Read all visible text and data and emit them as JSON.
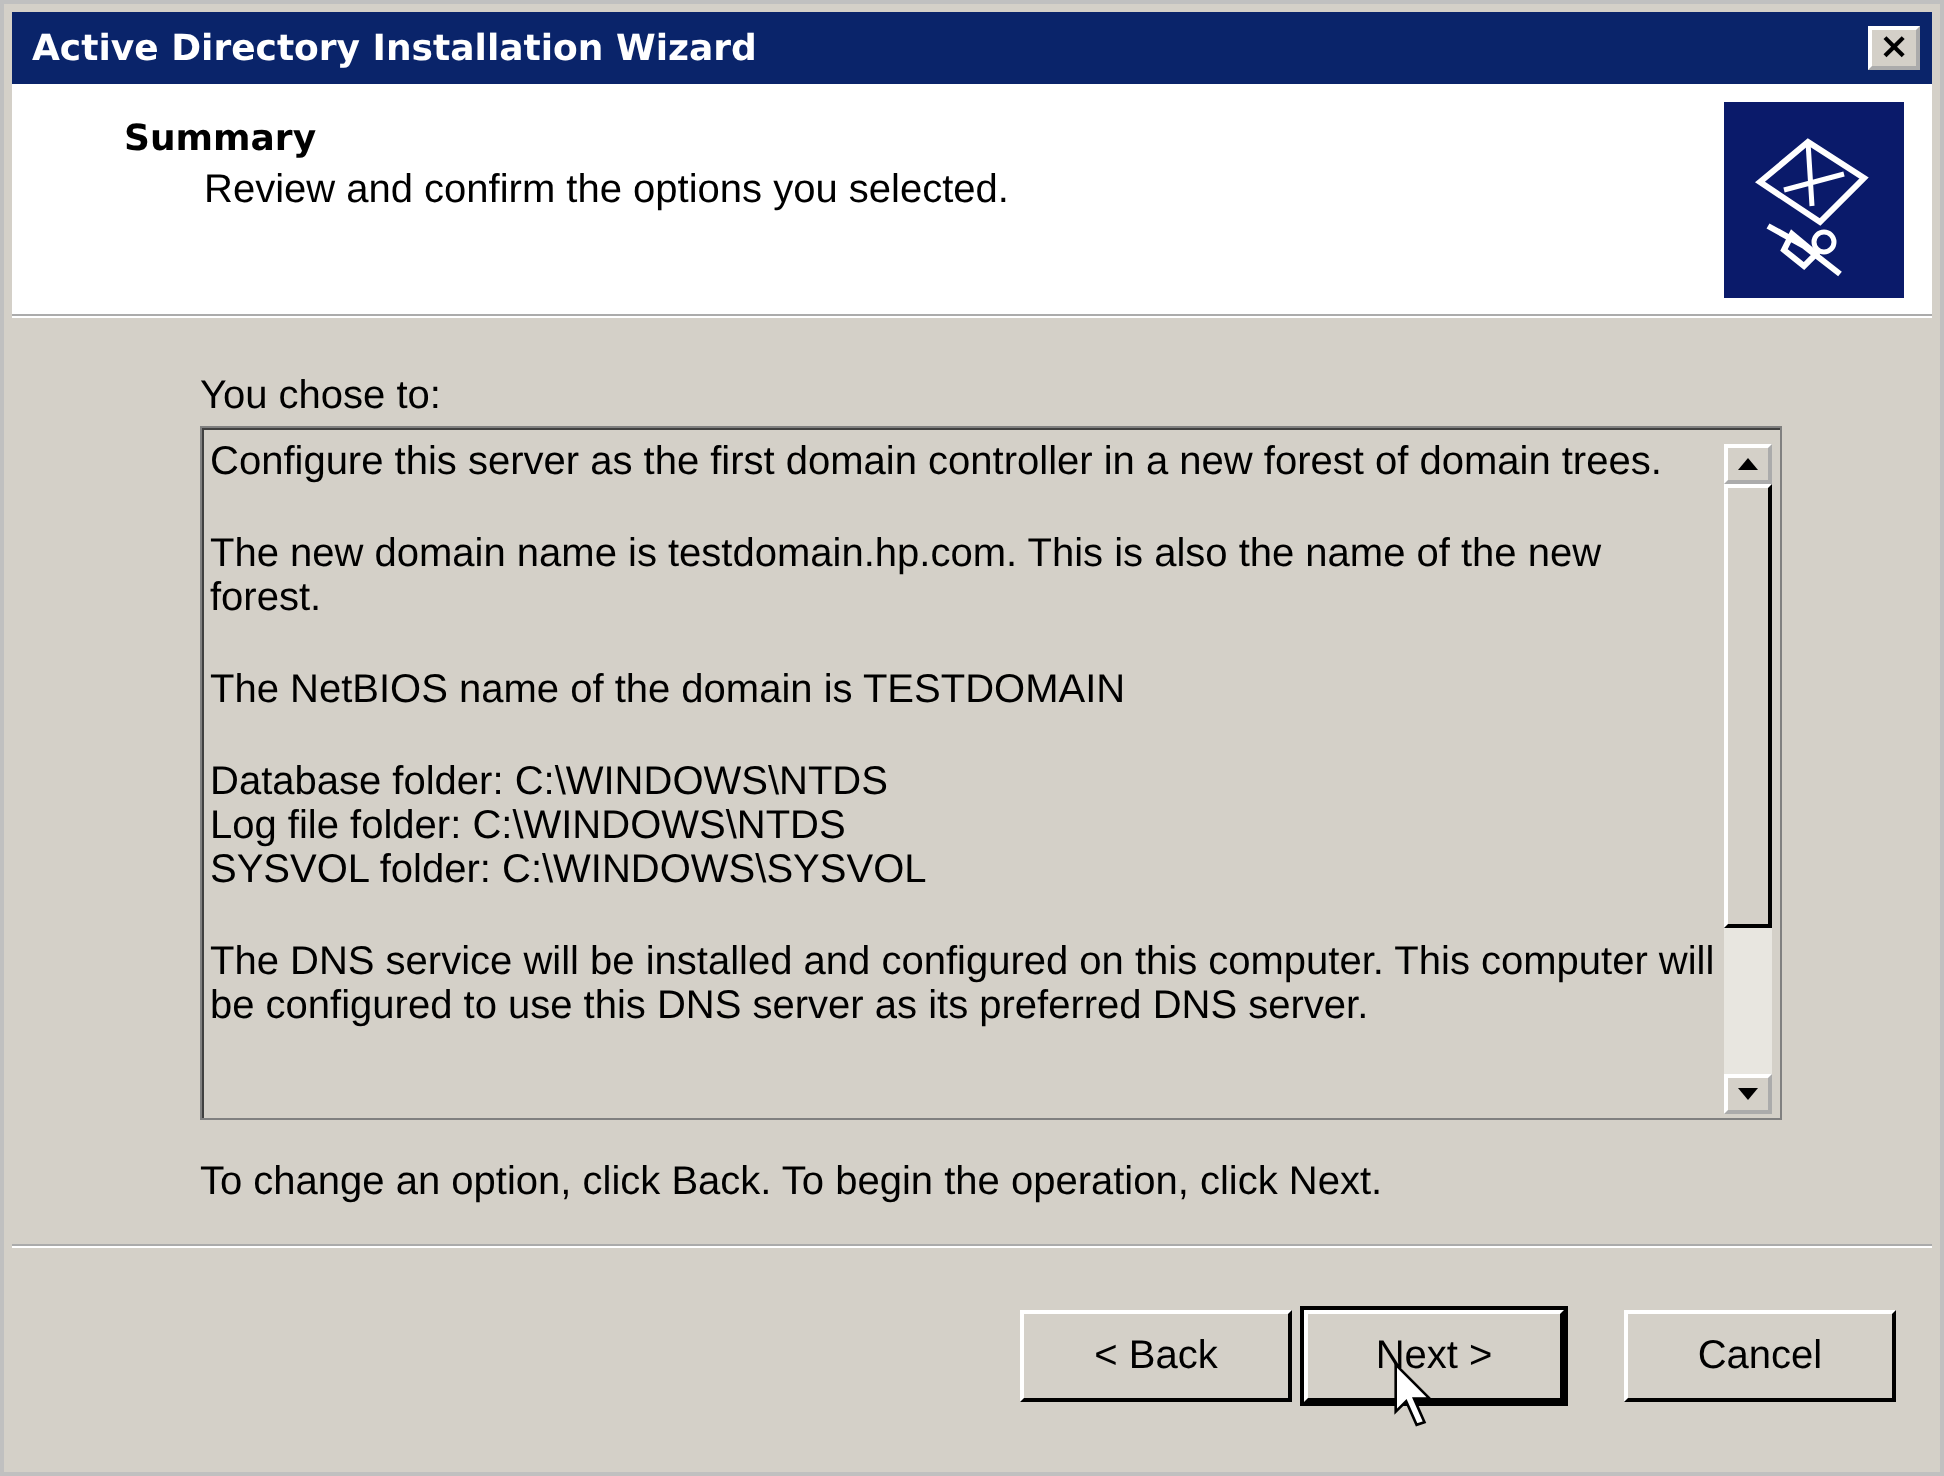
{
  "window": {
    "title": "Active Directory Installation Wizard",
    "close": "×"
  },
  "header": {
    "title": "Summary",
    "subtitle": "Review and confirm the options you selected."
  },
  "summary": {
    "label": "You chose to:",
    "paragraphs": [
      {
        "lines": [
          "Configure this server as the first domain controller in a new forest of domain trees."
        ]
      },
      {
        "lines": [
          "The new domain name is testdomain.hp.com. This is also the name of the new forest."
        ]
      },
      {
        "lines": [
          "The NetBIOS name of the domain is TESTDOMAIN"
        ]
      },
      {
        "lines": [
          "Database folder: C:\\WINDOWS\\NTDS",
          "Log file folder: C:\\WINDOWS\\NTDS",
          "SYSVOL folder: C:\\WINDOWS\\SYSVOL"
        ]
      },
      {
        "lines": [
          "The DNS service will be installed and configured on this computer. This computer will be configured to use this DNS server as its preferred DNS server."
        ]
      }
    ]
  },
  "hint": "To change an option, click Back. To begin the operation, click Next.",
  "buttons": [
    {
      "label": "< Back",
      "default": false
    },
    {
      "label": "Next >",
      "default": true
    },
    {
      "label": "Cancel",
      "default": false
    }
  ]
}
